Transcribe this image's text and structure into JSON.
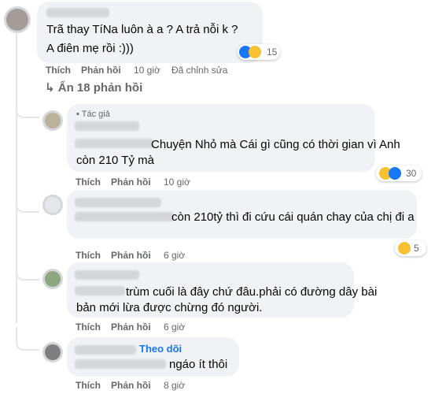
{
  "top_comment": {
    "lines": [
      "Trã thay TíNa luôn à a ? A trả nỗi k ?",
      "A điên mẹ rồi :)))"
    ],
    "reaction_count": "15",
    "actions": {
      "like": "Thích",
      "reply": "Phản hồi",
      "time": "10 giờ",
      "edited": "Đã chỉnh sửa"
    }
  },
  "toggle_replies_label": "Ẩn 18 phản hồi",
  "replies": [
    {
      "author_badge": "Tác giả",
      "lines": [
        "Chuyện Nhỏ mà Cái gì cũng có thời gian vì Anh",
        "còn 210 Tỷ mà"
      ],
      "reaction_count": "30",
      "actions": {
        "like": "Thích",
        "reply": "Phản hồi",
        "time": "10 giờ"
      }
    },
    {
      "lines": [
        "còn 210tỷ thì đi cứu cái quán chay của chị đi a"
      ],
      "reaction_count": "5",
      "actions": {
        "like": "Thích",
        "reply": "Phản hồi",
        "time": "6 giờ"
      }
    },
    {
      "lines": [
        "trùm cuối là đây chứ đâu.phải có đường dây bài",
        "bản mới lừa được chừng đó người."
      ],
      "actions": {
        "like": "Thích",
        "reply": "Phản hồi",
        "time": "6 giờ"
      }
    },
    {
      "follow_label": "Theo dõi",
      "lines": [
        "ngáo ít thôi"
      ],
      "actions": {
        "like": "Thích",
        "reply": "Phản hồi",
        "time": "8 giờ"
      }
    }
  ],
  "colors": {
    "bubble": "#f0f2f5",
    "meta": "#65676b",
    "link": "#1877f2",
    "haha": "#f7c131",
    "like": "#1877f2"
  }
}
